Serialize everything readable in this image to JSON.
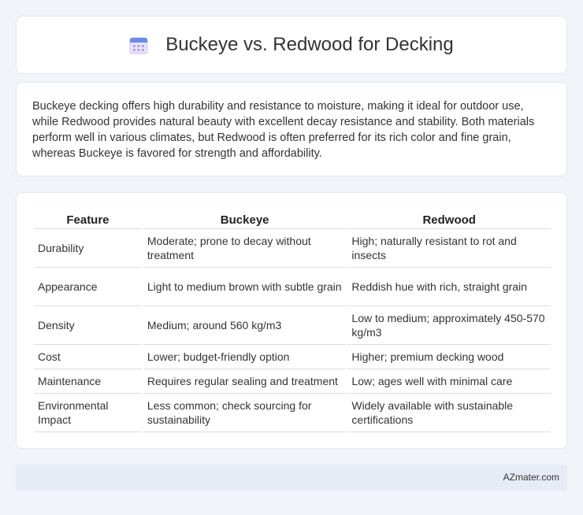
{
  "header": {
    "title": "Buckeye vs. Redwood for Decking",
    "icon": "calendar-icon"
  },
  "summary": {
    "text": "Buckeye decking offers high durability and resistance to moisture, making it ideal for outdoor use, while Redwood provides natural beauty with excellent decay resistance and stability. Both materials perform well in various climates, but Redwood is often preferred for its rich color and fine grain, whereas Buckeye is favored for strength and affordability."
  },
  "table": {
    "headers": [
      "Feature",
      "Buckeye",
      "Redwood"
    ],
    "rows": [
      [
        "Durability",
        "Moderate; prone to decay without treatment",
        "High; naturally resistant to rot and insects"
      ],
      [
        "Appearance",
        "Light to medium brown with subtle grain",
        "Reddish hue with rich, straight grain"
      ],
      [
        "Density",
        "Medium; around 560 kg/m3",
        "Low to medium; approximately 450-570 kg/m3"
      ],
      [
        "Cost",
        "Lower; budget-friendly option",
        "Higher; premium decking wood"
      ],
      [
        "Maintenance",
        "Requires regular sealing and treatment",
        "Low; ages well with minimal care"
      ],
      [
        "Environmental Impact",
        "Less common; check sourcing for sustainability",
        "Widely available with sustainable certifications"
      ]
    ]
  },
  "footer": {
    "text": "AZmater.com"
  }
}
